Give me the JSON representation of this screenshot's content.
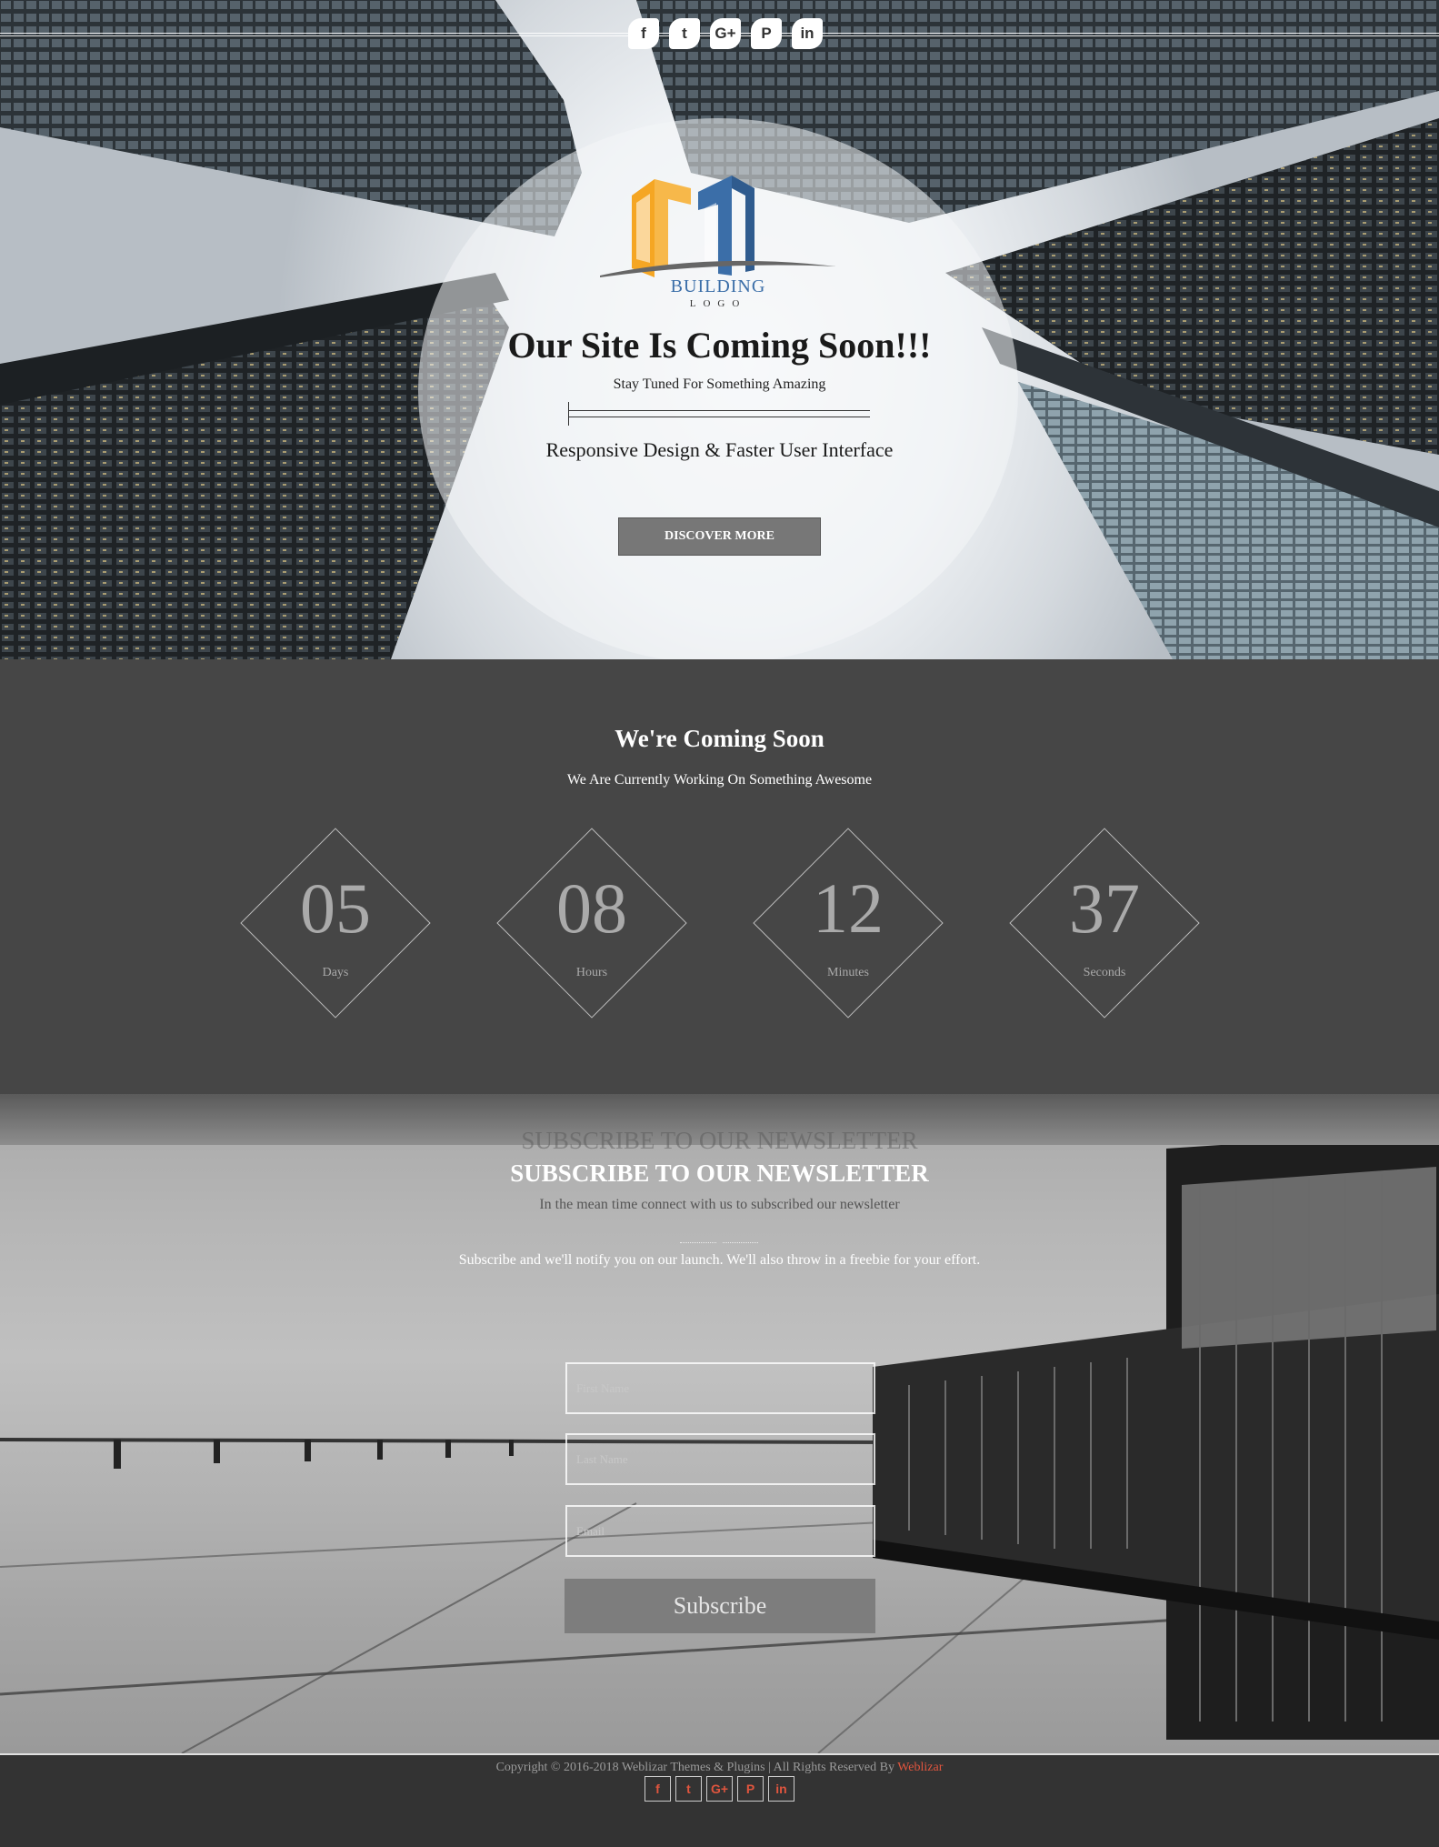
{
  "social": [
    {
      "name": "facebook",
      "glyph": "f"
    },
    {
      "name": "twitter",
      "glyph": "t"
    },
    {
      "name": "google-plus",
      "glyph": "G+"
    },
    {
      "name": "pinterest",
      "glyph": "P"
    },
    {
      "name": "linkedin",
      "glyph": "in"
    }
  ],
  "hero": {
    "logo_line1": "BUILDING",
    "logo_line2": "LOGO",
    "title": "Our Site Is Coming Soon!!!",
    "subtitle": "Stay Tuned For Something Amazing",
    "tagline": "Responsive Design & Faster User Interface",
    "button_label": "DISCOVER MORE"
  },
  "countdown": {
    "title": "We're Coming Soon",
    "subtitle": "We Are Currently Working On Something Awesome",
    "items": [
      {
        "value": "05",
        "label": "Days"
      },
      {
        "value": "08",
        "label": "Hours"
      },
      {
        "value": "12",
        "label": "Minutes"
      },
      {
        "value": "37",
        "label": "Seconds"
      }
    ]
  },
  "newsletter": {
    "ghost_title": "SUBSCRIBE TO OUR NEWSLETTER",
    "title": "SUBSCRIBE TO OUR NEWSLETTER",
    "subtitle": "In the mean time connect with us to subscribed our newsletter",
    "description": "Subscribe and we'll notify you on our launch. We'll also throw in a freebie for your effort.",
    "fields": {
      "first_name_placeholder": "First Name",
      "last_name_placeholder": "Last Name",
      "email_placeholder": "Email"
    },
    "button_label": "Subscribe"
  },
  "footer": {
    "copyright_prefix": "Copyright © 2016-2018 Weblizar Themes & Plugins | All Rights Reserved By ",
    "brand": "Weblizar"
  },
  "colors": {
    "accent": "#e0553e",
    "logo_orange": "#f5a623",
    "logo_blue": "#3b6ea8",
    "dark_bg": "#464646",
    "footer_bg": "#333333"
  }
}
